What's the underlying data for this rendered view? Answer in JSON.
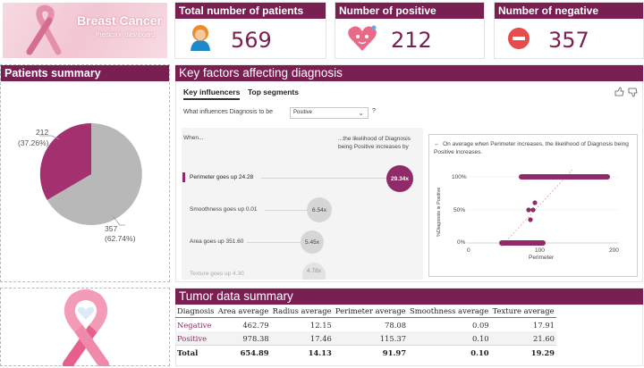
{
  "logo": {
    "title": "Breast Cancer",
    "subtitle": "Prediction dashboard"
  },
  "kpis": [
    {
      "label": "Total number of patients",
      "value": "569",
      "icon": "patient-icon"
    },
    {
      "label": "Number of positive",
      "value": "212",
      "icon": "heart-icon"
    },
    {
      "label": "Number of negative",
      "value": "357",
      "icon": "minus-icon"
    }
  ],
  "patients_summary": {
    "title": "Patients summary",
    "slices": [
      {
        "label": "212",
        "pct": "(37.26%)",
        "value": 212,
        "color": "#a3316f"
      },
      {
        "label": "357",
        "pct": "(62.74%)",
        "value": 357,
        "color": "#b8b8b8"
      }
    ]
  },
  "key_factors": {
    "title": "Key factors affecting diagnosis",
    "tabs": [
      "Key influencers",
      "Top segments"
    ],
    "question": "What influences Diagnosis to be",
    "selected": "Positive",
    "help": "?",
    "when": "When...",
    "likelihood": "...the likelihood of Diagnosis being Positive increases by",
    "influencers": [
      {
        "label": "Perimeter goes up 24.28",
        "value": "29.34x"
      },
      {
        "label": "Smoothness goes up 0.01",
        "value": "6.54x"
      },
      {
        "label": "Area goes up 351.60",
        "value": "5.45x"
      },
      {
        "label": "Texture goes up 4.30",
        "value": "4.78x"
      }
    ],
    "detail_text": "On average when Perimeter increases, the likelihood of Diagnosis being Positive increases.",
    "detail_chart": {
      "ylabel": "%Diagnosis is Positive",
      "xlabel": "Perimeter",
      "yticks": [
        "100%",
        "50%",
        "0%"
      ],
      "xticks": [
        "0",
        "100",
        "200"
      ]
    }
  },
  "tumor": {
    "title": "Tumor data summary",
    "columns": [
      "Diagnosis",
      "Area average",
      "Radius average",
      "Perimeter average",
      "Smoothness average",
      "Texture average"
    ],
    "rows": [
      [
        "Negative",
        "462.79",
        "12.15",
        "78.08",
        "0.09",
        "17.91"
      ],
      [
        "Positive",
        "978.38",
        "17.46",
        "115.37",
        "0.10",
        "21.60"
      ],
      [
        "Total",
        "654.89",
        "14.13",
        "91.97",
        "0.10",
        "19.29"
      ]
    ]
  },
  "colors": {
    "brand": "#7a1f52",
    "accent": "#a3316f",
    "neutral": "#b8b8b8"
  }
}
